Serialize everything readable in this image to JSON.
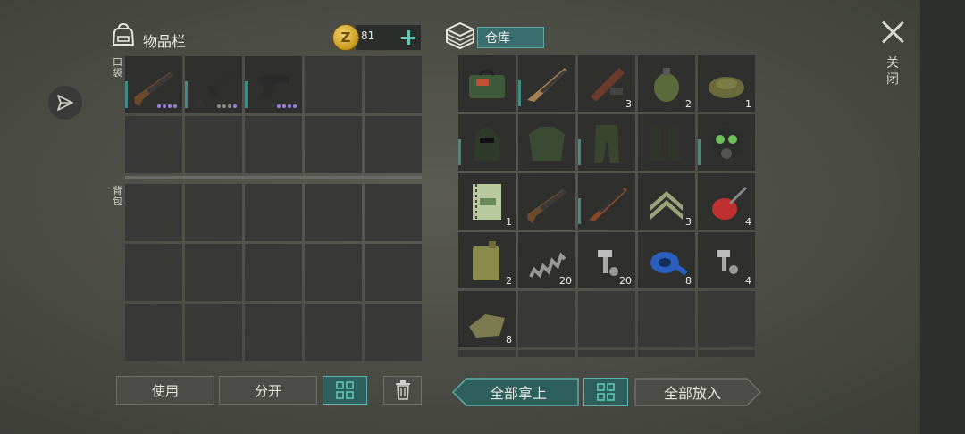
{
  "close": {
    "label": "关闭"
  },
  "inventory": {
    "title": "物品栏",
    "coin_symbol": "Z",
    "coin_count": "81",
    "pocket_label": "口袋",
    "backpack_label": "背包"
  },
  "storage": {
    "title": "仓库"
  },
  "pocket_slots": [
    {
      "icon": "shotgun-icon",
      "dots": [
        "#9a7de0",
        "#9a7de0",
        "#9a7de0",
        "#9a7de0"
      ]
    },
    {
      "icon": "assault-rifle-icon",
      "dots": [
        "#8a8a8a",
        "#8a8a8a",
        "#8a8a8a",
        "#9a7de0"
      ]
    },
    {
      "icon": "pistol-icon",
      "dots": [
        "#9a7de0",
        "#9a7de0",
        "#9a7de0",
        "#9a7de0"
      ]
    },
    {
      "icon": "",
      "dots": []
    },
    {
      "icon": "",
      "dots": []
    }
  ],
  "storage_items": [
    {
      "icon": "explosive-case-icon",
      "count": ""
    },
    {
      "icon": "rifle-icon",
      "count": ""
    },
    {
      "icon": "launcher-parts-icon",
      "count": "3"
    },
    {
      "icon": "grenade-icon",
      "count": "2"
    },
    {
      "icon": "landmine-icon",
      "count": "1"
    },
    {
      "icon": "balaclava-icon",
      "count": ""
    },
    {
      "icon": "camo-jacket-icon",
      "count": ""
    },
    {
      "icon": "camo-pants-icon",
      "count": ""
    },
    {
      "icon": "boots-icon",
      "count": ""
    },
    {
      "icon": "gas-mask-icon",
      "count": ""
    },
    {
      "icon": "notebook-icon",
      "count": "1"
    },
    {
      "icon": "shotgun-icon",
      "count": ""
    },
    {
      "icon": "ak-rifle-icon",
      "count": ""
    },
    {
      "icon": "rank-chevron-icon",
      "count": "3"
    },
    {
      "icon": "oil-can-icon",
      "count": "4"
    },
    {
      "icon": "jerrycan-icon",
      "count": "2"
    },
    {
      "icon": "spring-icon",
      "count": "20"
    },
    {
      "icon": "bolt-icon",
      "count": "20"
    },
    {
      "icon": "duct-tape-icon",
      "count": "8"
    },
    {
      "icon": "bolt-nut-icon",
      "count": "4"
    },
    {
      "icon": "cloth-icon",
      "count": "8"
    },
    {
      "icon": "",
      "count": ""
    },
    {
      "icon": "",
      "count": ""
    },
    {
      "icon": "",
      "count": ""
    },
    {
      "icon": "",
      "count": ""
    }
  ],
  "buttons": {
    "use": "使用",
    "split": "分开",
    "take_all": "全部拿上",
    "put_all": "全部放入"
  },
  "colors": {
    "accent": "#3f8b86",
    "teal_button": "#2d5f5d"
  }
}
